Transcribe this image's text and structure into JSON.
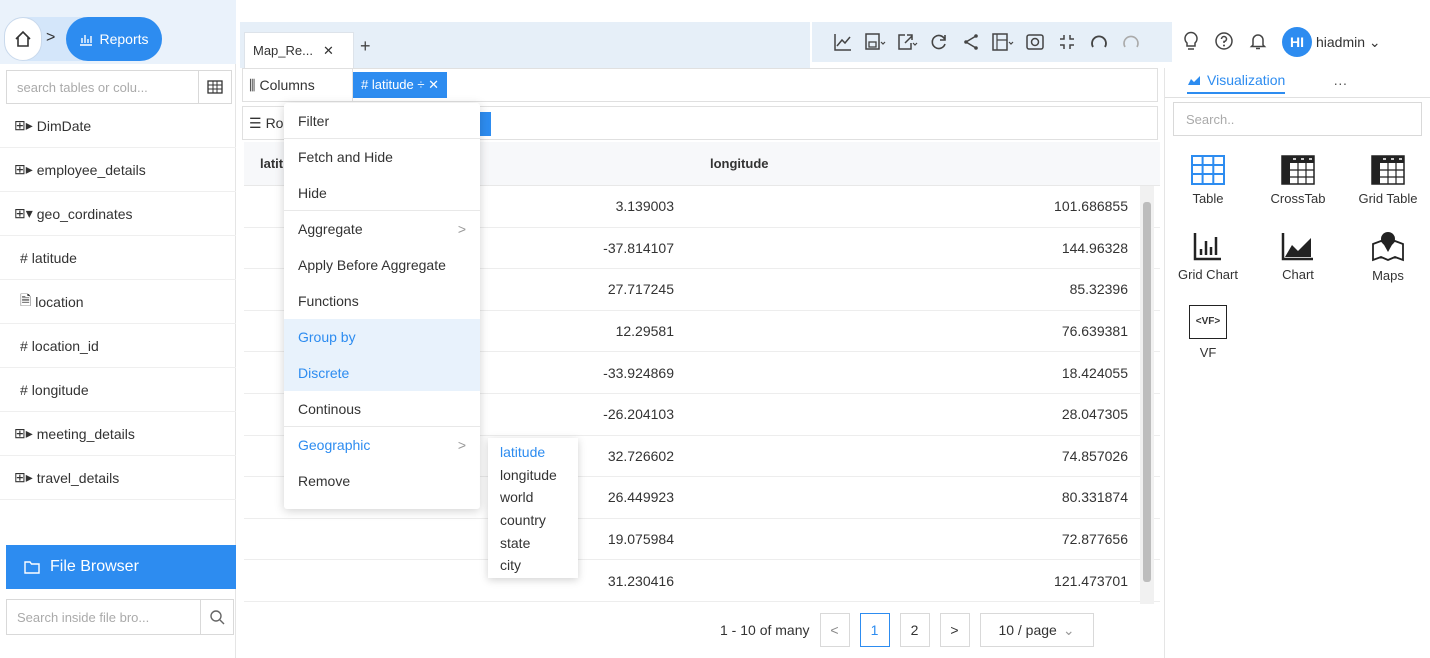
{
  "nav": {
    "reports_label": "Reports"
  },
  "tab": {
    "title": "Map_Re...",
    "close": "✕",
    "add": "+"
  },
  "user": {
    "initials": "HI",
    "name": "hiadmin"
  },
  "sidebar": {
    "search_placeholder": "search tables or colu...",
    "items": [
      {
        "label": "DimDate",
        "prefix": "⊞▸",
        "child": false
      },
      {
        "label": "employee_details",
        "prefix": "⊞▸",
        "child": false
      },
      {
        "label": "geo_cordinates",
        "prefix": "⊞▾",
        "child": false
      },
      {
        "label": "latitude",
        "prefix": "#",
        "child": true
      },
      {
        "label": "location",
        "prefix": "🗎",
        "child": true
      },
      {
        "label": "location_id",
        "prefix": "#",
        "child": true
      },
      {
        "label": "longitude",
        "prefix": "#",
        "child": true
      },
      {
        "label": "meeting_details",
        "prefix": "⊞▸",
        "child": false
      },
      {
        "label": "travel_details",
        "prefix": "⊞▸",
        "child": false
      }
    ],
    "file_browser_label": "File Browser",
    "file_search_placeholder": "Search inside file bro..."
  },
  "shelves": {
    "columns_label": "Columns",
    "columns_chip": "# latitude ÷ ✕",
    "rows_label": "Ro"
  },
  "grid": {
    "col_latitude": "latit",
    "col_longitude": "longitude",
    "rows": [
      {
        "lat": "3.139003",
        "lon": "101.686855"
      },
      {
        "lat": "-37.814107",
        "lon": "144.96328"
      },
      {
        "lat": "27.717245",
        "lon": "85.32396"
      },
      {
        "lat": "12.29581",
        "lon": "76.639381"
      },
      {
        "lat": "-33.924869",
        "lon": "18.424055"
      },
      {
        "lat": "-26.204103",
        "lon": "28.047305"
      },
      {
        "lat": "32.726602",
        "lon": "74.857026"
      },
      {
        "lat": "26.449923",
        "lon": "80.331874"
      },
      {
        "lat": "19.075984",
        "lon": "72.877656"
      },
      {
        "lat": "31.230416",
        "lon": "121.473701"
      }
    ]
  },
  "pager": {
    "summary": "1 - 10 of many",
    "prev": "<",
    "next": ">",
    "page1": "1",
    "page2": "2",
    "page_size": "10 / page"
  },
  "context_menu": {
    "items": [
      {
        "label": "Filter",
        "sep": true,
        "state": "",
        "arrow": ""
      },
      {
        "label": "Fetch and Hide",
        "sep": false,
        "state": "",
        "arrow": ""
      },
      {
        "label": "Hide",
        "sep": true,
        "state": "",
        "arrow": ""
      },
      {
        "label": "Aggregate",
        "sep": false,
        "state": "",
        "arrow": ">"
      },
      {
        "label": "Apply Before Aggregate",
        "sep": false,
        "state": "",
        "arrow": ""
      },
      {
        "label": "Functions",
        "sep": false,
        "state": "",
        "arrow": ""
      },
      {
        "label": "Group by",
        "sep": false,
        "state": "hl",
        "arrow": ""
      },
      {
        "label": "Discrete",
        "sep": false,
        "state": "hl",
        "arrow": ""
      },
      {
        "label": "Continous",
        "sep": true,
        "state": "",
        "arrow": ""
      },
      {
        "label": "Geographic",
        "sep": false,
        "state": "blue",
        "arrow": ">"
      },
      {
        "label": "Remove",
        "sep": false,
        "state": "",
        "arrow": ""
      }
    ]
  },
  "geo_submenu": {
    "items": [
      {
        "label": "latitude",
        "active": true
      },
      {
        "label": "longitude",
        "active": false
      },
      {
        "label": "world",
        "active": false
      },
      {
        "label": "country",
        "active": false
      },
      {
        "label": "state",
        "active": false
      },
      {
        "label": "city",
        "active": false
      }
    ]
  },
  "visualization": {
    "tab_label": "Visualization",
    "more": "···",
    "search_placeholder": "Search..",
    "items": [
      {
        "label": "Table",
        "icon": "table-icon"
      },
      {
        "label": "CrossTab",
        "icon": "crosstab-icon"
      },
      {
        "label": "Grid Table",
        "icon": "grid-table-icon"
      },
      {
        "label": "Grid Chart",
        "icon": "grid-chart-icon"
      },
      {
        "label": "Chart",
        "icon": "chart-icon"
      },
      {
        "label": "Maps",
        "icon": "maps-icon"
      },
      {
        "label": "VF",
        "icon": "vf-icon",
        "glyph": "<VF>"
      }
    ]
  },
  "colors": {
    "accent": "#2d8cf0",
    "highlight": "#e8f2fc"
  }
}
